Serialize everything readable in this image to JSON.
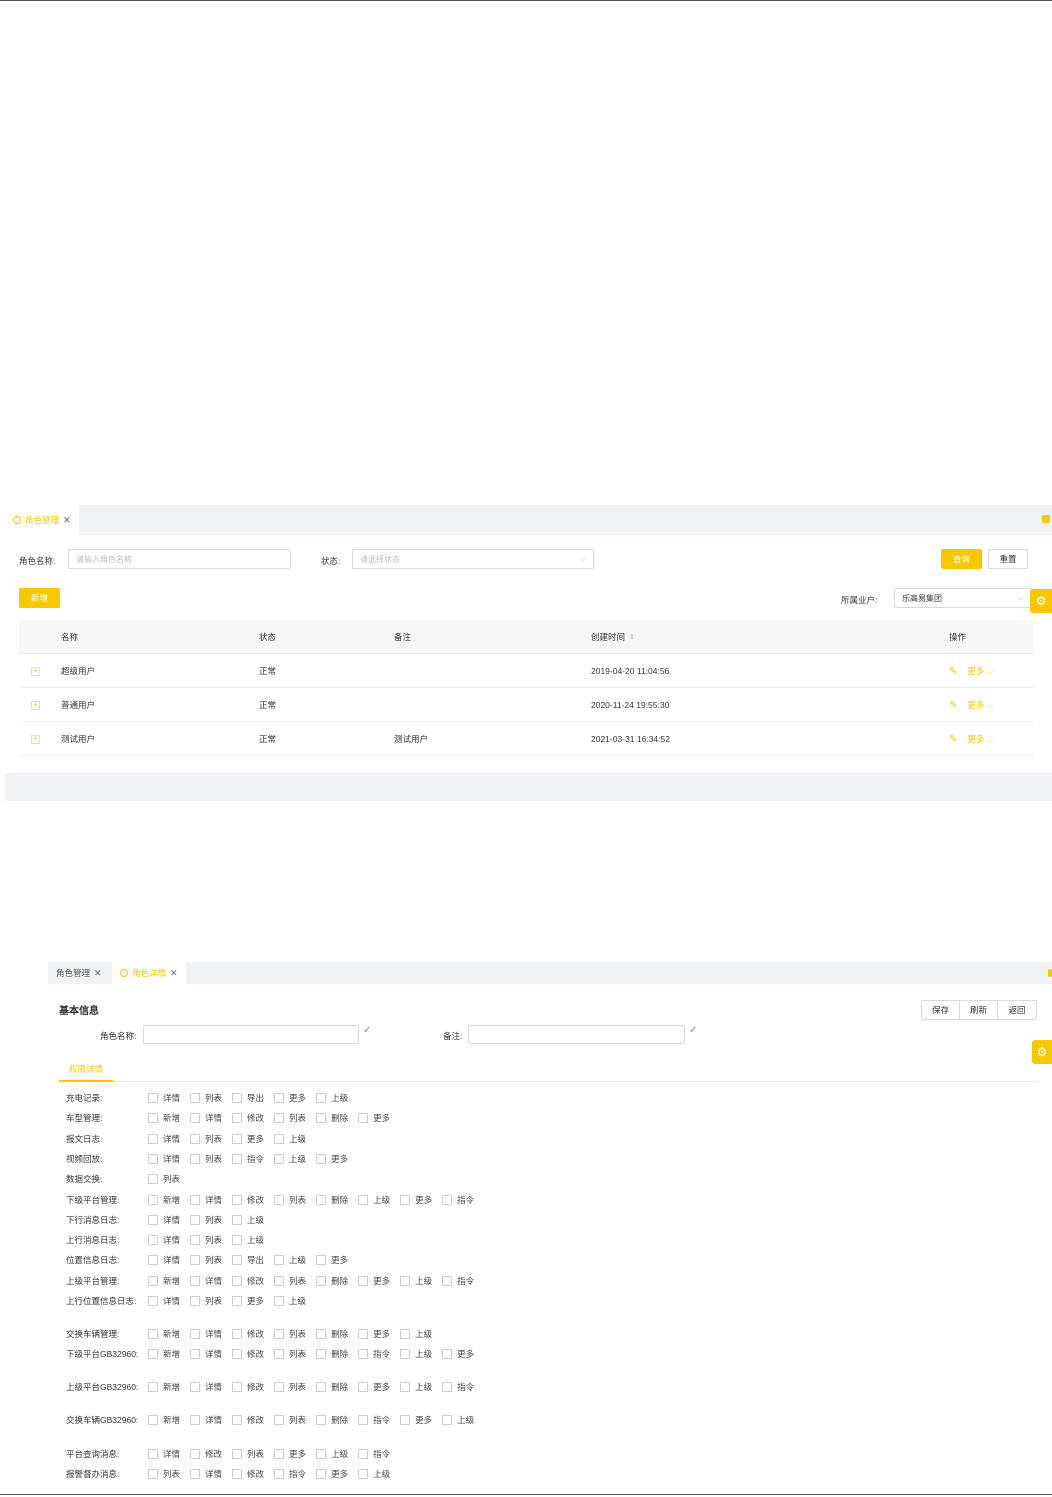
{
  "colors": {
    "accent": "#f7c800",
    "border": "#d9d9d9",
    "bg": "#f0f2f5"
  },
  "list_page": {
    "tabs": [
      {
        "label": "角色管理",
        "active": true
      }
    ],
    "search": {
      "name_label": "角色名称:",
      "name_placeholder": "请输入角色名称",
      "status_label": "状态:",
      "status_placeholder": "请选择状态",
      "query_button": "查询",
      "reset_button": "重置"
    },
    "add_button": "新增",
    "tenant": {
      "label": "所属业户:",
      "value": "乐高易集团"
    },
    "table": {
      "headers": {
        "name": "名称",
        "status": "状态",
        "remark": "备注",
        "created": "创建时间",
        "action": "操作"
      },
      "rows": [
        {
          "name": "超级用户",
          "status": "正常",
          "remark": "",
          "created": "2019-04-20 11:04:56",
          "more": "更多"
        },
        {
          "name": "普通用户",
          "status": "正常",
          "remark": "",
          "created": "2020-11-24 19:55:30",
          "more": "更多"
        },
        {
          "name": "测试用户",
          "status": "正常",
          "remark": "测试用户",
          "created": "2021-03-31 16:34:52",
          "more": "更多"
        }
      ]
    }
  },
  "detail_page": {
    "tabs": [
      {
        "label": "角色管理",
        "active": false
      },
      {
        "label": "角色详情",
        "active": true
      }
    ],
    "section_title": "基本信息",
    "buttons": {
      "save": "保存",
      "refresh": "刷新",
      "back": "返回"
    },
    "fields": {
      "role_name_label": "角色名称:",
      "remark_label": "备注:"
    },
    "subtab": "权限详情",
    "permissions": [
      {
        "label": "充电记录:",
        "options": [
          "详情",
          "列表",
          "导出",
          "更多",
          "上级"
        ]
      },
      {
        "label": "车型管理:",
        "options": [
          "新增",
          "详情",
          "修改",
          "列表",
          "删除",
          "更多"
        ]
      },
      {
        "label": "报文日志:",
        "options": [
          "详情",
          "列表",
          "更多",
          "上级"
        ]
      },
      {
        "label": "视频回放:",
        "options": [
          "详情",
          "列表",
          "指令",
          "上级",
          "更多"
        ]
      },
      {
        "label": "数据交换:",
        "options": [
          "列表"
        ]
      },
      {
        "label": "下级平台管理:",
        "options": [
          "新增",
          "详情",
          "修改",
          "列表",
          "删除",
          "上级",
          "更多",
          "指令"
        ]
      },
      {
        "label": "下行消息日志:",
        "options": [
          "详情",
          "列表",
          "上级"
        ]
      },
      {
        "label": "上行消息日志:",
        "options": [
          "详情",
          "列表",
          "上级"
        ]
      },
      {
        "label": "位置信息日志:",
        "options": [
          "详情",
          "列表",
          "导出",
          "上级",
          "更多"
        ]
      },
      {
        "label": "上级平台管理:",
        "options": [
          "新增",
          "详情",
          "修改",
          "列表",
          "删除",
          "更多",
          "上级",
          "指令"
        ]
      },
      {
        "label": "上行位置信息日志:",
        "options": [
          "详情",
          "列表",
          "更多",
          "上级"
        ]
      },
      {
        "label": "交换车辆管理:",
        "options": [
          "新增",
          "详情",
          "修改",
          "列表",
          "删除",
          "更多",
          "上级"
        ]
      },
      {
        "label": "下级平台GB32960:",
        "options": [
          "新增",
          "详情",
          "修改",
          "列表",
          "删除",
          "指令",
          "上级",
          "更多"
        ]
      },
      {
        "label": "上级平台GB32960:",
        "options": [
          "新增",
          "详情",
          "修改",
          "列表",
          "删除",
          "更多",
          "上级",
          "指令"
        ]
      },
      {
        "label": "交换车辆GB32960:",
        "options": [
          "新增",
          "详情",
          "修改",
          "列表",
          "删除",
          "指令",
          "更多",
          "上级"
        ]
      },
      {
        "label": "平台查询消息:",
        "options": [
          "详情",
          "修改",
          "列表",
          "更多",
          "上级",
          "指令"
        ]
      },
      {
        "label": "报警督办消息:",
        "options": [
          "列表",
          "详情",
          "修改",
          "指令",
          "更多",
          "上级"
        ]
      }
    ]
  }
}
